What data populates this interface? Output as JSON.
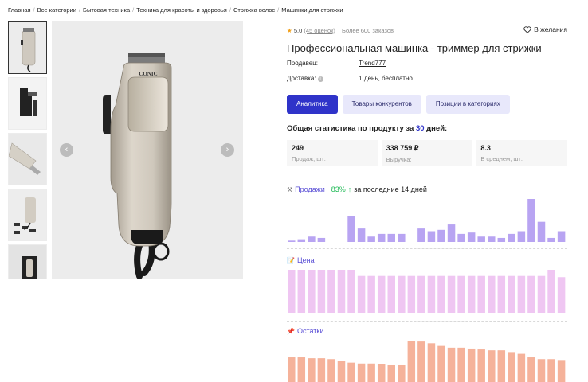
{
  "breadcrumbs": [
    "Главная",
    "Все категории",
    "Бытовая техника",
    "Техника для красоты и здоровья",
    "Стрижка волос",
    "Машинки для стрижки"
  ],
  "rating": {
    "score": "5.0",
    "reviews": "(45 оценок)",
    "orders": "Более 600 заказов"
  },
  "wishlist_label": "В желания",
  "product_title": "Профессиональная машинка - триммер для стрижки",
  "seller": {
    "label": "Продавец:",
    "value": "Trend777"
  },
  "delivery": {
    "label": "Доставка:",
    "value": "1 день, бесплатно"
  },
  "tabs": [
    {
      "label": "Аналитика",
      "active": true
    },
    {
      "label": "Товары конкурентов",
      "active": false
    },
    {
      "label": "Позиции в категориях",
      "active": false
    }
  ],
  "stats": {
    "title_prefix": "Общая статистика по продукту за",
    "days": "30",
    "title_suffix": "дней:",
    "boxes": [
      {
        "value": "249",
        "label": "Продаж, шт:"
      },
      {
        "value": "338 759 ₽",
        "label": "Выручка:"
      },
      {
        "value": "8.3",
        "label": "В среднем, шт:"
      }
    ]
  },
  "sales": {
    "label": "Продажи",
    "percent": "83%",
    "period": "за последние 14 дней",
    "color": "#b8a4f2",
    "values": [
      1,
      2,
      4,
      3,
      0,
      0,
      19,
      10,
      4,
      6,
      6,
      6,
      0,
      10,
      8,
      9,
      13,
      6,
      7,
      4,
      4,
      3,
      6,
      8,
      32,
      15,
      3,
      8
    ]
  },
  "price": {
    "label": "Цена",
    "color": "#efc6f2",
    "values": [
      35,
      35,
      35,
      35,
      35,
      35,
      35,
      30,
      30,
      30,
      30,
      30,
      30,
      30,
      30,
      30,
      30,
      30,
      30,
      30,
      30,
      30,
      30,
      30,
      30,
      30,
      35,
      29
    ]
  },
  "stock": {
    "label": "Остатки",
    "color": "#f5b29a",
    "values": [
      28,
      28,
      27,
      27,
      26,
      24,
      22,
      21,
      21,
      20,
      19,
      19,
      47,
      46,
      44,
      41,
      39,
      39,
      38,
      37,
      36,
      36,
      34,
      32,
      28,
      26,
      26,
      25
    ]
  },
  "nav": {
    "prev": "‹",
    "next": "›"
  }
}
